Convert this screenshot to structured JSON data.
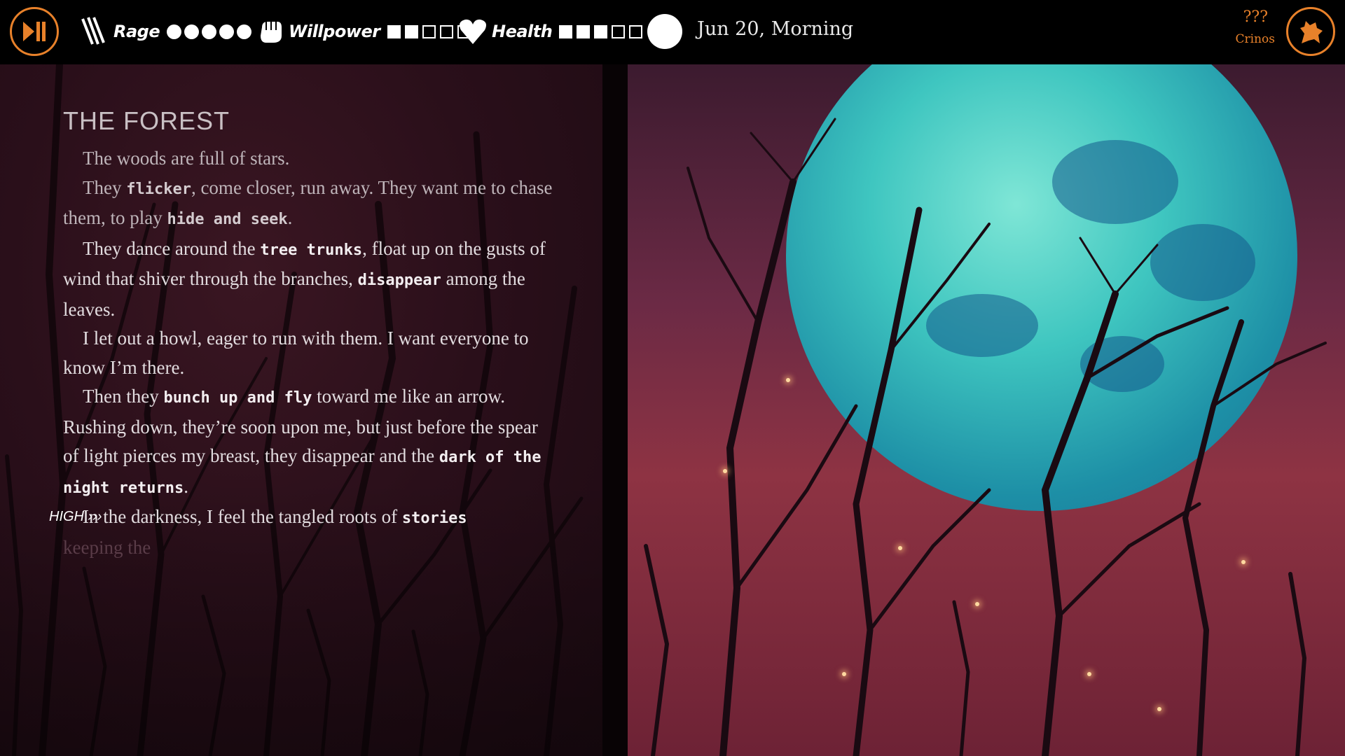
{
  "hud": {
    "rage_label": "Rage",
    "rage_value": 5,
    "rage_max": 5,
    "willpower_label": "Willpower",
    "willpower_value": 2,
    "willpower_max": 5,
    "health_label": "Health",
    "health_value": 3,
    "health_max": 5,
    "date": "Jun 20, Morning",
    "form_unknown": "???",
    "form_name": "Crinos",
    "colors": {
      "accent": "#e8812a"
    }
  },
  "story": {
    "title": "THE FOREST",
    "p1": "The woods are full of stars.",
    "p2_a": "They ",
    "p2_kw1": "flicker",
    "p2_b": ", come closer, run away. They want me to chase them, to play ",
    "p2_kw2": "hide and seek",
    "p2_c": ".",
    "p3_a": "They dance around the ",
    "p3_kw1": "tree trunks",
    "p3_b": ", float up on the gusts of wind that shiver through the branches, ",
    "p3_kw2": "disappear",
    "p3_c": " among the leaves.",
    "p4": "I let out a howl, eager to run with them. I want everyone to know I’m there.",
    "p5_a": "Then they ",
    "p5_kw1": "bunch up and fly",
    "p5_b": " toward me like an arrow. Rushing down, they’re soon upon me, but just before the spear of light pierces my breast, they disappear and the ",
    "p5_kw2": "dark of the night returns",
    "p5_c": ".",
    "high_tag": "HIGH ›››",
    "p6_a": "In the darkness, I feel the tangled roots of ",
    "p6_kw": "stories",
    "fade_line": "keeping the"
  }
}
